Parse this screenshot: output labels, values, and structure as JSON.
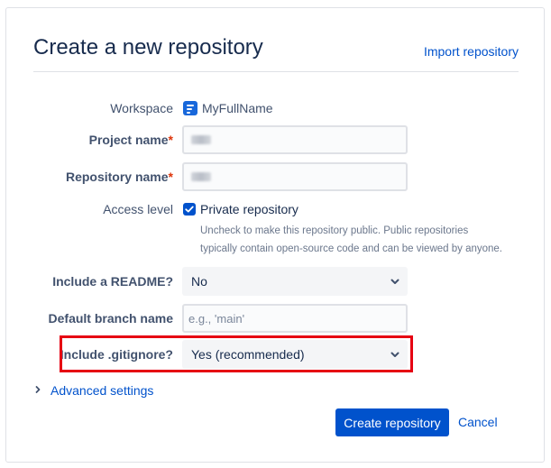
{
  "header": {
    "title": "Create a new repository",
    "import_link": "Import repository"
  },
  "form": {
    "workspace": {
      "label": "Workspace",
      "value": "MyFullName",
      "icon": "workspace-icon"
    },
    "project_name": {
      "label": "Project name",
      "required_mark": "*",
      "value_blurred": true
    },
    "repository_name": {
      "label": "Repository name",
      "required_mark": "*",
      "value_blurred": true
    },
    "access_level": {
      "label": "Access level",
      "checkbox_label": "Private repository",
      "checked": true,
      "help_line1": "Uncheck to make this repository public. Public repositories",
      "help_line2": "typically contain open-source code and can be viewed by anyone."
    },
    "readme": {
      "label": "Include a README?",
      "value": "No"
    },
    "default_branch": {
      "label": "Default branch name",
      "placeholder": "e.g., 'main'"
    },
    "gitignore": {
      "label": "Include .gitignore?",
      "value": "Yes (recommended)"
    },
    "advanced": {
      "label": "Advanced settings"
    }
  },
  "actions": {
    "create": "Create repository",
    "cancel": "Cancel"
  },
  "colors": {
    "primary": "#0052cc",
    "required": "#de350b",
    "highlight": "#e60012"
  }
}
